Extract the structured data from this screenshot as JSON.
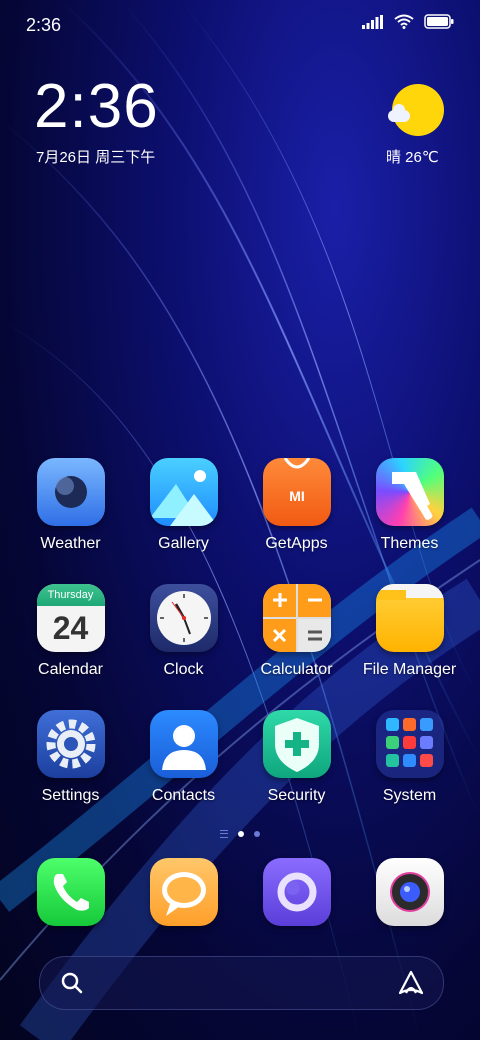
{
  "status_bar": {
    "time": "2:36"
  },
  "clock_widget": {
    "time": "2:36",
    "date": "7月26日 周三下午"
  },
  "weather_widget": {
    "text": "晴 26℃"
  },
  "apps": [
    {
      "label": "Weather"
    },
    {
      "label": "Gallery"
    },
    {
      "label": "GetApps"
    },
    {
      "label": "Themes"
    },
    {
      "label": "Calendar"
    },
    {
      "label": "Clock"
    },
    {
      "label": "Calculator"
    },
    {
      "label": "File Manager"
    },
    {
      "label": "Settings"
    },
    {
      "label": "Contacts"
    },
    {
      "label": "Security"
    },
    {
      "label": "System"
    }
  ],
  "calendar_icon": {
    "weekday": "Thursday",
    "day": "24"
  },
  "getapps_icon": {
    "text": "MI"
  },
  "page_indicator": {
    "pages": 2,
    "current": 1
  },
  "dock": [
    {
      "icon": "phone-icon"
    },
    {
      "icon": "messaging-icon"
    },
    {
      "icon": "browser-icon"
    },
    {
      "icon": "camera-icon"
    }
  ],
  "search_bar": {
    "left_icon": "search-icon",
    "right_icon": "assistant-icon"
  }
}
